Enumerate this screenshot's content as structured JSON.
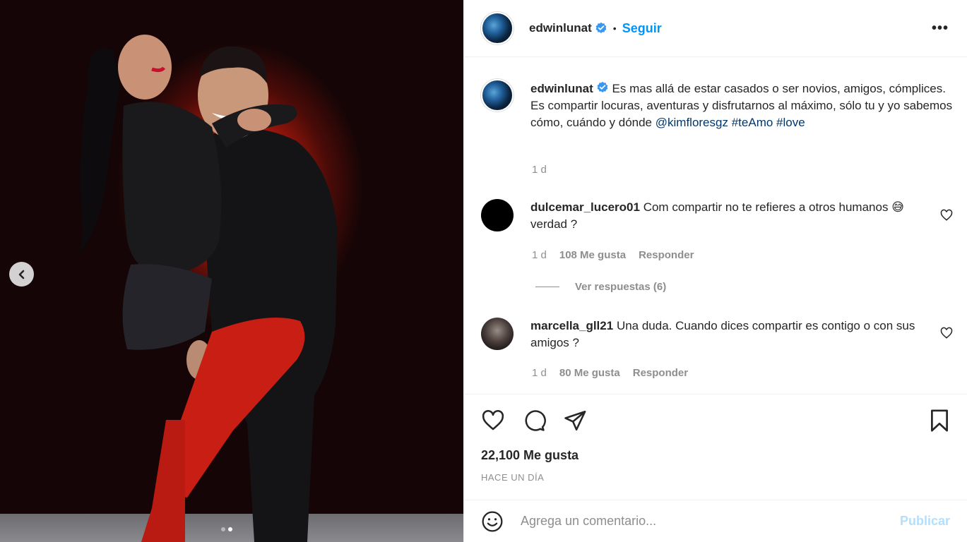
{
  "post": {
    "username": "edwinlunat",
    "follow_label": "Seguir",
    "bullet": "•",
    "more_label": "•••",
    "caption_text": "Es mas allá de estar casados o ser novios, amigos, cómplices. Es compartir locuras, aventuras y disfrutarnos al máximo, sólo tu y yo sabemos cómo, cuándo y dónde",
    "caption_mention": "@kimfloresgz",
    "caption_tag1": "#teAmo",
    "caption_tag2": "#love",
    "caption_age": "1 d",
    "likes": "22,100 Me gusta",
    "time_ago": "HACE UN DÍA",
    "carousel": {
      "index": 2,
      "total": 2
    }
  },
  "comments": [
    {
      "username": "dulcemar_lucero01",
      "text_a": "Com compartir no te refieres a otros humanos",
      "emoji": "😅",
      "text_b": "verdad ?",
      "age": "1 d",
      "likes": "108 Me gusta",
      "reply": "Responder",
      "view_replies": "Ver respuestas (6)"
    },
    {
      "username": "marcella_gll21",
      "text": "Una duda. Cuando dices compartir es contigo o con sus amigos ?",
      "age": "1 d",
      "likes": "80 Me gusta",
      "reply": "Responder"
    }
  ],
  "composer": {
    "placeholder": "Agrega un comentario...",
    "publish_label": "Publicar"
  },
  "icons": [
    "verified-badge-icon",
    "heart-icon",
    "comment-icon",
    "share-icon",
    "bookmark-icon",
    "emoji-icon",
    "chevron-left-icon",
    "more-icon"
  ],
  "colors": {
    "accent": "#0095f6",
    "link": "#00376b",
    "muted": "#8e8e8e",
    "publish_disabled": "#b2dffc"
  }
}
